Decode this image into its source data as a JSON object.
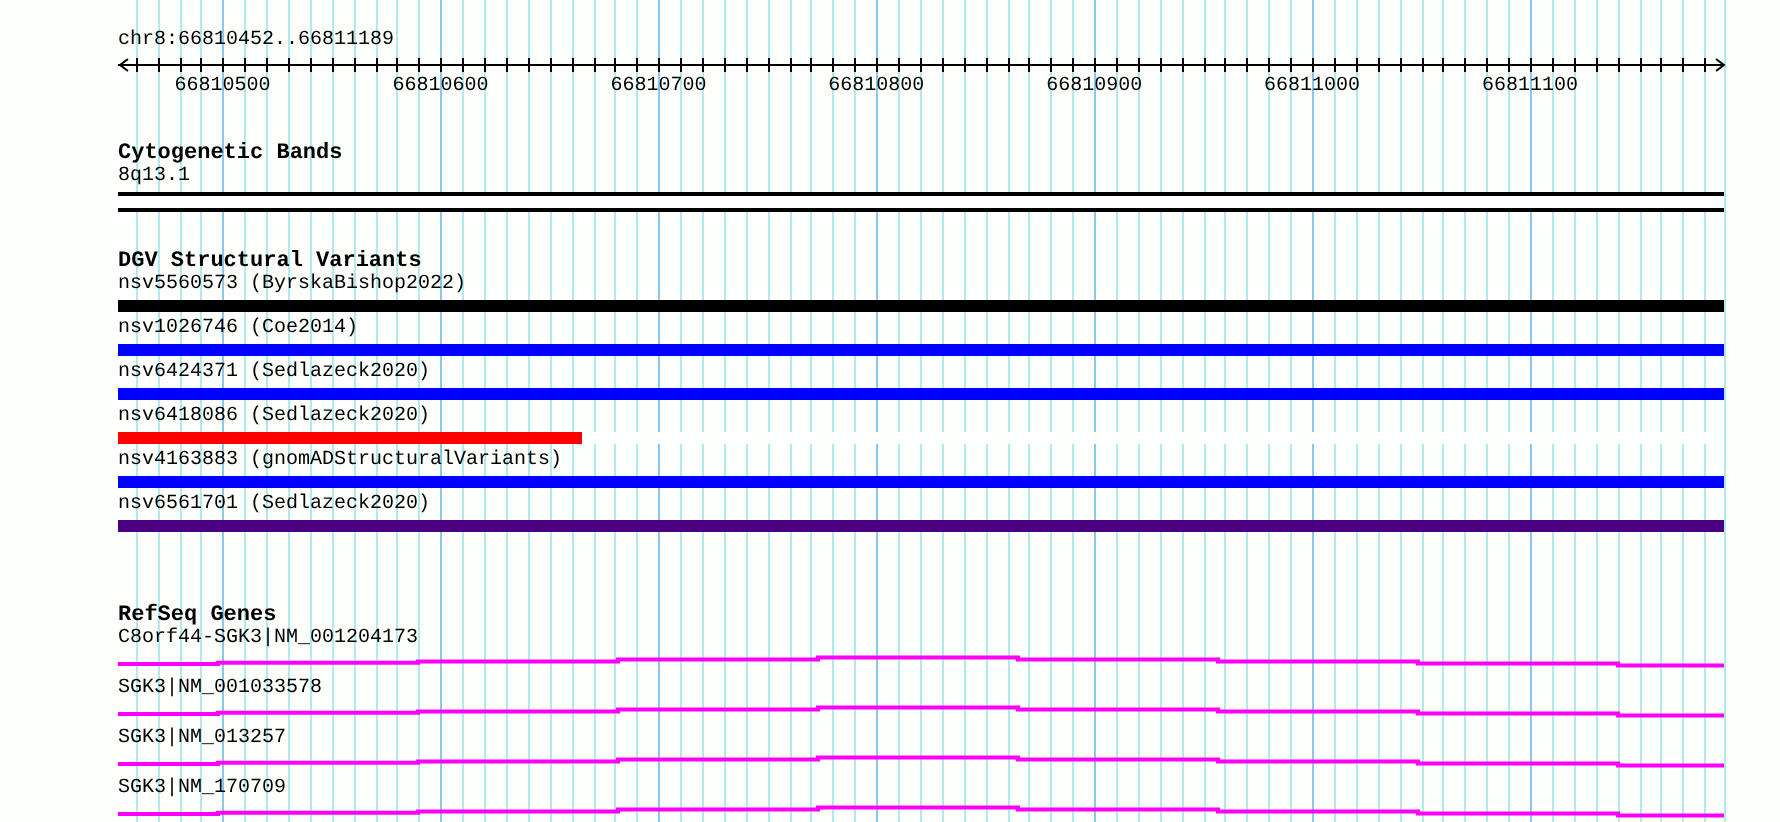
{
  "location": "chr8:66810452..66811189",
  "ruler": {
    "ticks": [
      "66810500",
      "66810600",
      "66810700",
      "66810800",
      "66810900",
      "66811000",
      "66811100"
    ]
  },
  "tracks": [
    {
      "kind": "bands",
      "title": "Cytogenetic Bands",
      "features": [
        {
          "label": "8q13.1"
        }
      ]
    },
    {
      "kind": "variants",
      "title": "DGV Structural Variants",
      "features": [
        {
          "label": "nsv5560573 (ByrskaBishop2022)",
          "color": "#000000"
        },
        {
          "label": "nsv1026746 (Coe2014)",
          "color": "#0000ff"
        },
        {
          "label": "nsv6424371 (Sedlazeck2020)",
          "color": "#0000ff"
        },
        {
          "label": "nsv6418086 (Sedlazeck2020)",
          "color": "#ff0000",
          "level": 0.289
        },
        {
          "label": "nsv4163883 (gnomADStructuralVariants)",
          "color": "#0000ff"
        },
        {
          "label": "nsv6561701 (Sedlazeck2020)",
          "color": "#4b0082"
        }
      ]
    },
    {
      "kind": "genes",
      "title": "RefSeq Genes",
      "features": [
        {
          "label": "C8orf44-SGK3|NM_001204173"
        },
        {
          "label": "SGK3|NM_001033578"
        },
        {
          "label": "SGK3|NM_013257"
        },
        {
          "label": "SGK3|NM_170709"
        }
      ]
    }
  ]
}
